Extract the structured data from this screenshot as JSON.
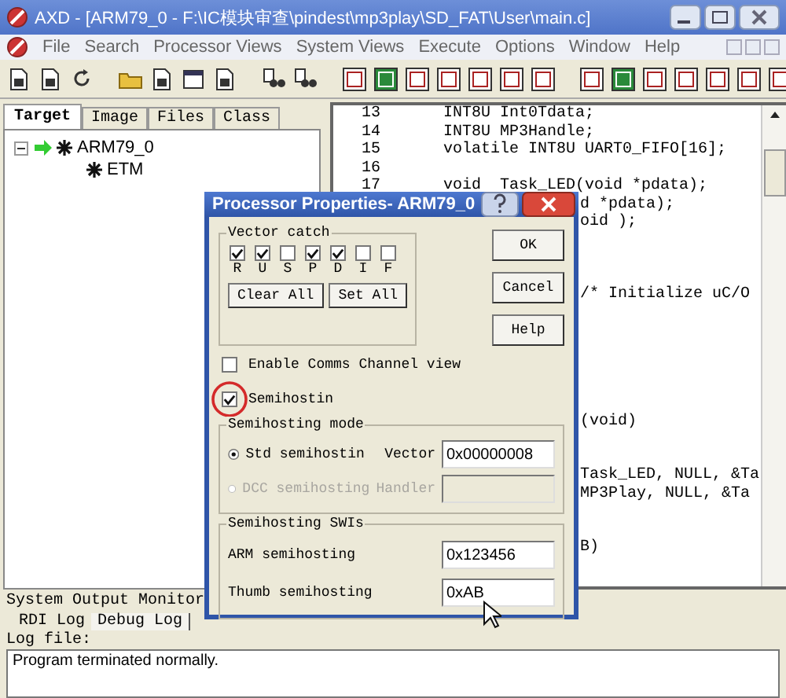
{
  "window": {
    "title": "AXD - [ARM79_0 - F:\\IC模块审查\\pindest\\mp3play\\SD_FAT\\User\\main.c]"
  },
  "menu": [
    {
      "label": "File"
    },
    {
      "label": "Search"
    },
    {
      "label": "Processor Views"
    },
    {
      "label": "System Views"
    },
    {
      "label": "Execute"
    },
    {
      "label": "Options"
    },
    {
      "label": "Window"
    },
    {
      "label": "Help"
    }
  ],
  "left_panel": {
    "tabs": [
      {
        "label": "Target",
        "selected": true
      },
      {
        "label": "Image",
        "selected": false
      },
      {
        "label": "Files",
        "selected": false
      },
      {
        "label": "Class",
        "selected": false
      }
    ],
    "tree": [
      {
        "label": "ARM79_0",
        "expanded": true,
        "children": [
          {
            "label": "ETM"
          }
        ]
      }
    ]
  },
  "editor": {
    "lines": [
      {
        "number": "13",
        "code": "INT8U Int0Tdata;"
      },
      {
        "number": "14",
        "code": "INT8U MP3Handle;"
      },
      {
        "number": "15",
        "code": "volatile INT8U UART0_FIFO[16];"
      },
      {
        "number": "16"
      },
      {
        "number": "17",
        "code": "void  Task_LED(void *pdata);"
      },
      {
        "code": "d *pdata);"
      },
      {
        "code": "oid );"
      },
      {
        "code": "/* Initialize uC/O"
      },
      {
        "code": "(void)"
      },
      {
        "code": "Task_LED, NULL, &Ta"
      },
      {
        "code": "MP3Play, NULL, &Ta"
      },
      {
        "code": "B)"
      }
    ]
  },
  "dialog": {
    "title": "Processor Properties- ARM79_0",
    "vector_catch": {
      "title": "Vector catch",
      "flags": [
        {
          "label": "R",
          "checked": true
        },
        {
          "label": "U",
          "checked": true
        },
        {
          "label": "S",
          "checked": false
        },
        {
          "label": "P",
          "checked": true
        },
        {
          "label": "D",
          "checked": true
        },
        {
          "label": "I",
          "checked": false
        },
        {
          "label": "F",
          "checked": false
        }
      ],
      "buttons": [
        "Clear All",
        "Set All"
      ]
    },
    "buttons": [
      "OK",
      "Cancel",
      "Help"
    ],
    "checkboxes": [
      {
        "label": "Enable Comms Channel view",
        "checked": false,
        "highlighted": false
      },
      {
        "label": "Semihostin",
        "checked": true,
        "highlighted": true
      }
    ],
    "semihosting_mode": {
      "title": "Semihosting mode",
      "options": [
        {
          "label": "Std semihostin",
          "selected": true,
          "disabled": false,
          "field_label": "Vector",
          "value": "0x00000008"
        },
        {
          "label": "DCC semihosting",
          "selected": false,
          "disabled": true,
          "field_label": "Handler"
        }
      ]
    },
    "semihosting_swis": {
      "title": "Semihosting SWIs",
      "fields": [
        {
          "label": "ARM semihosting",
          "value": "0x123456"
        },
        {
          "label": "Thumb semihosting",
          "value": "0xAB"
        }
      ]
    }
  },
  "output": {
    "title": "System Output Monitor",
    "tabs": [
      {
        "label": "RDI Log",
        "selected": false
      },
      {
        "label": "Debug Log",
        "selected": true
      }
    ],
    "log_label": "Log file:",
    "log_text": "Program terminated normally."
  }
}
